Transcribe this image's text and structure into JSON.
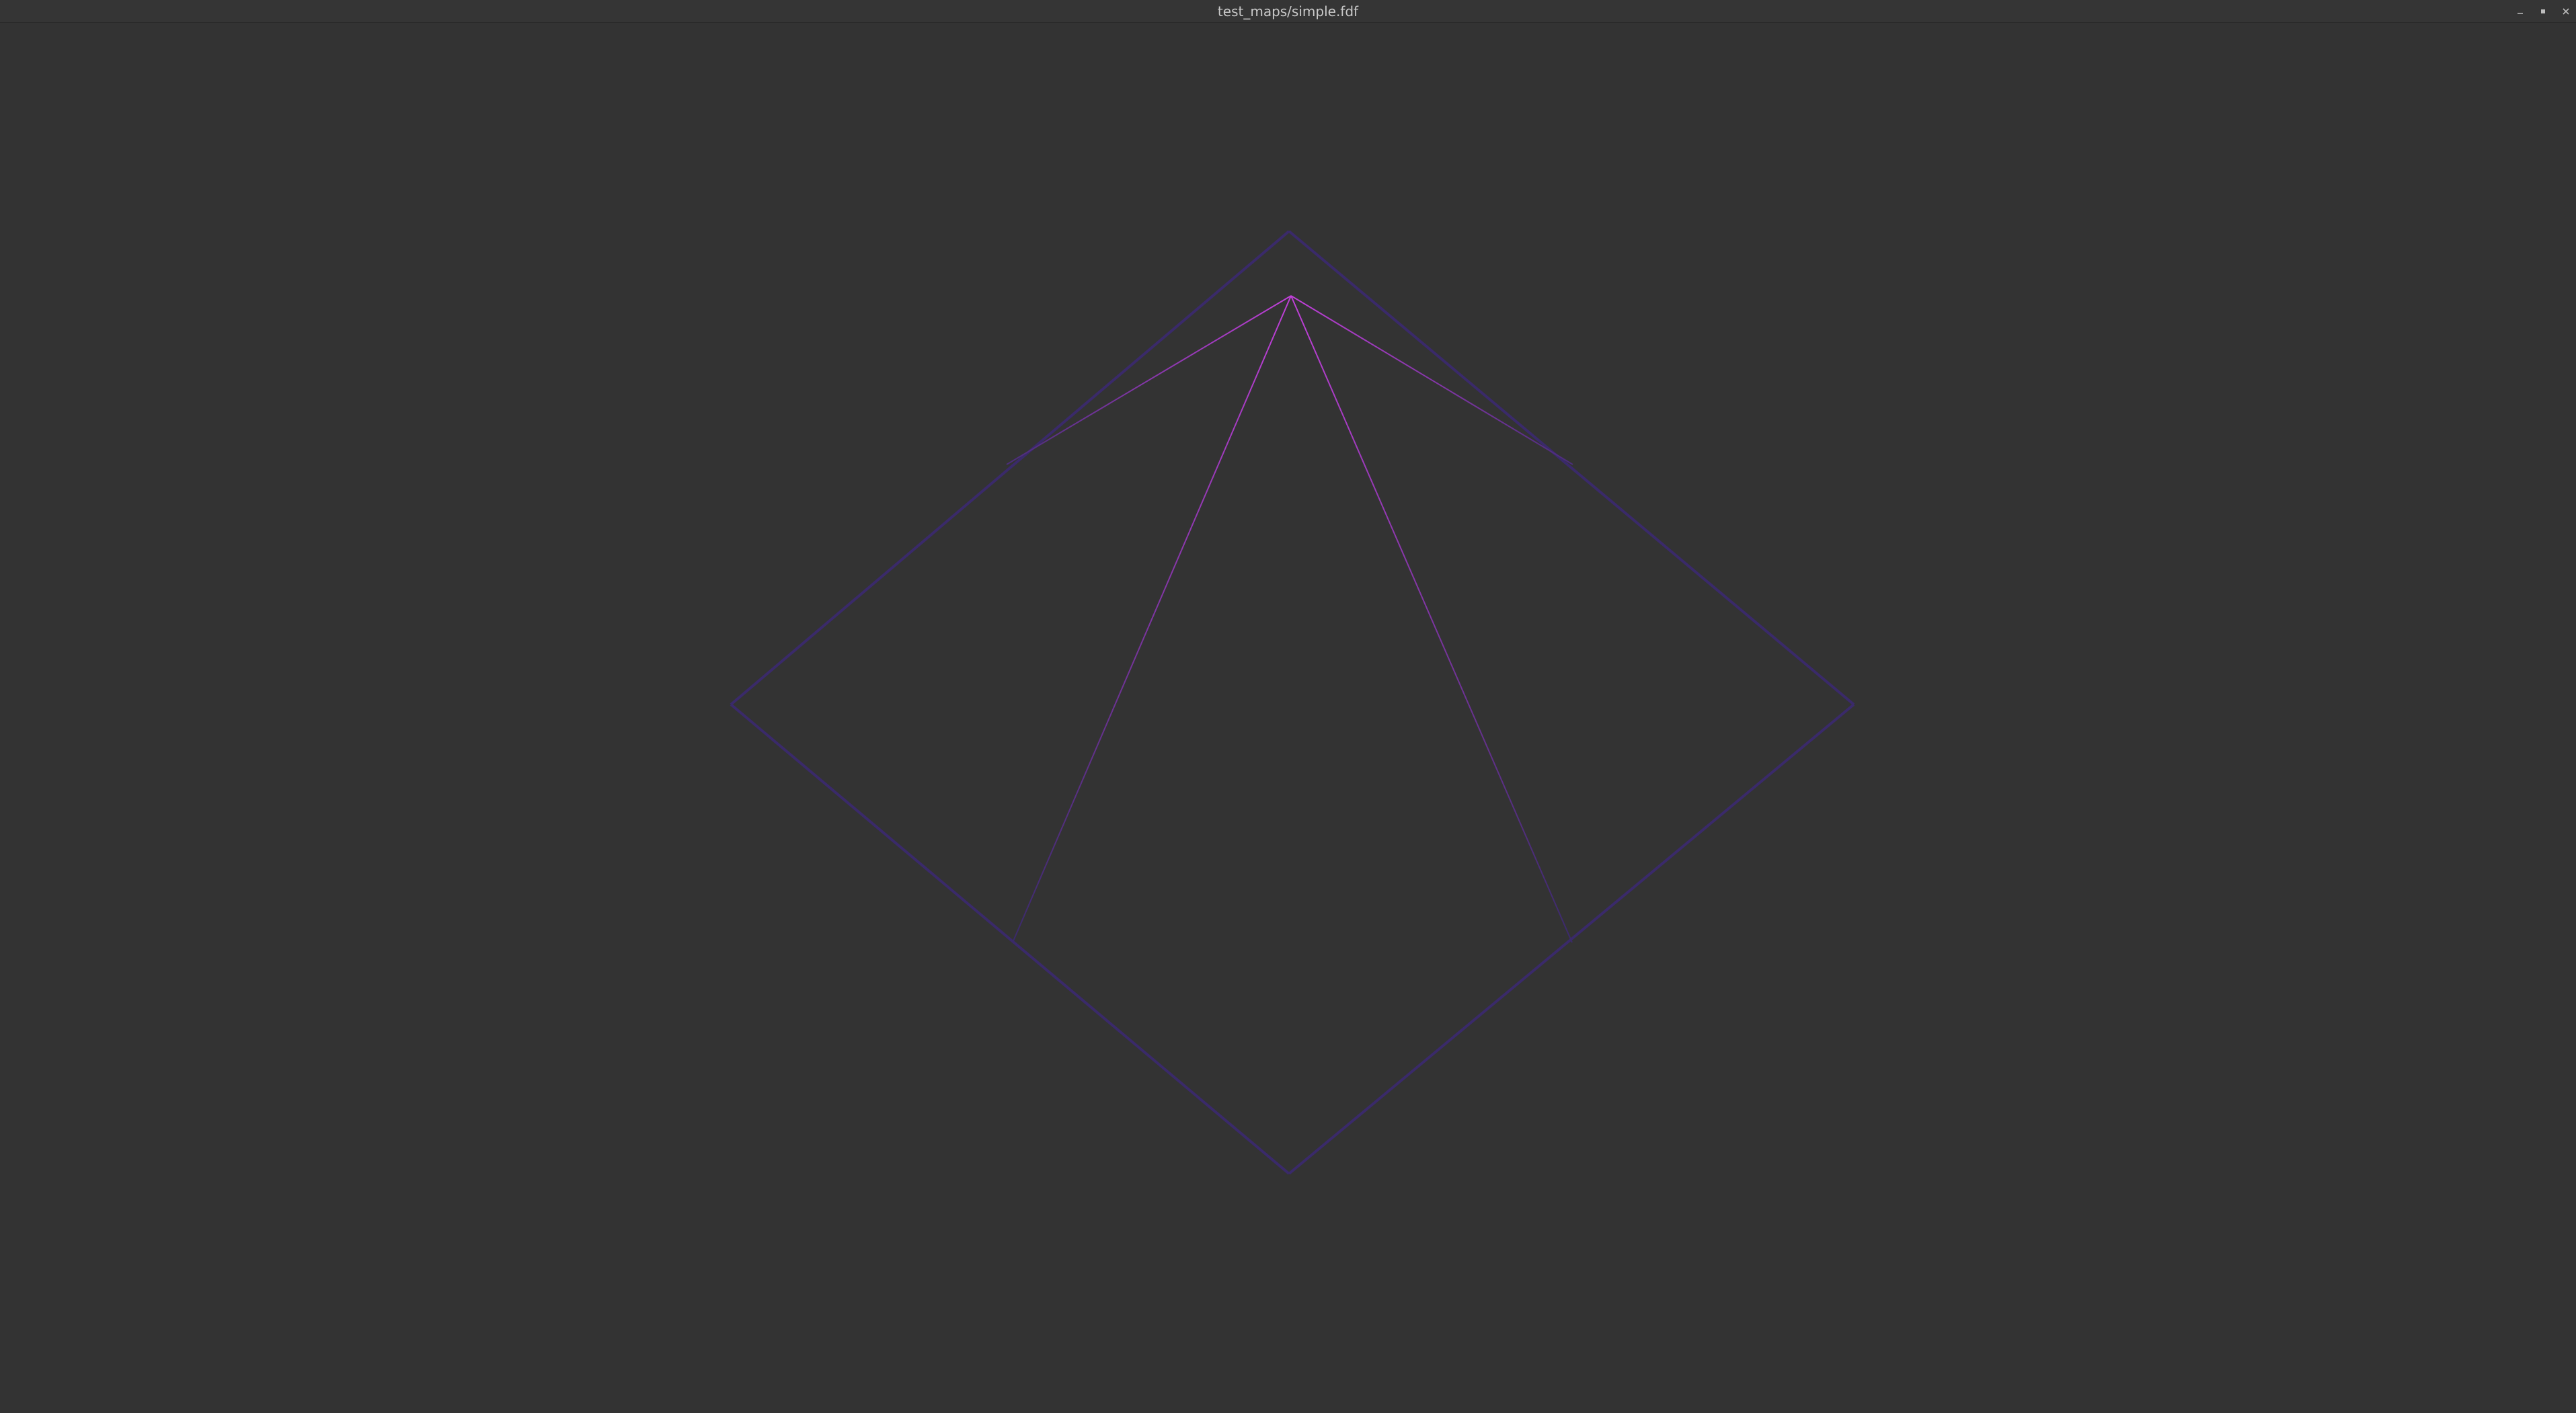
{
  "window": {
    "title": "test_maps/simple.fdf",
    "controls": {
      "minimize_icon": "minimize-icon",
      "maximize_icon": "maximize-icon",
      "close_icon": "close-icon"
    }
  },
  "colors": {
    "background": "#333333",
    "titlebar": "#353535",
    "title_text": "#c9c9c9",
    "base_edge": "#3a2a6a",
    "peak_edge": "#c040d8"
  }
}
